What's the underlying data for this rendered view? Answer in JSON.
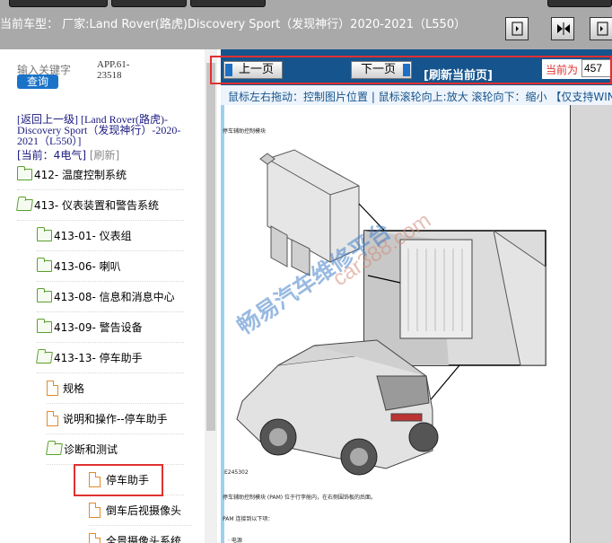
{
  "header": {
    "car_model": "当前车型：  厂家:Land Rover(路虎)Discovery Sport（发现神行）2020-2021（L550）"
  },
  "sidebar": {
    "keyword_placeholder": "输入关键字",
    "app_code": "APP.61-23518",
    "query_label": "查询",
    "back_link": "[返回上一级]  [Land Rover(路虎)-Discovery Sport（发现神行）-2020-2021（L550）]",
    "current": "[当前：4电气]",
    "refresh": "[刷新]",
    "tree": [
      {
        "label": "412- 温度控制系统",
        "icon": "folder-icon",
        "level": 0
      },
      {
        "label": "413- 仪表装置和警告系统",
        "icon": "folder-open-icon",
        "level": 0
      },
      {
        "label": "413-01- 仪表组",
        "icon": "folder-icon",
        "level": 1
      },
      {
        "label": "413-06- 喇叭",
        "icon": "folder-icon",
        "level": 1
      },
      {
        "label": "413-08- 信息和消息中心",
        "icon": "folder-icon",
        "level": 1
      },
      {
        "label": "413-09- 警告设备",
        "icon": "folder-icon",
        "level": 1
      },
      {
        "label": "413-13- 停车助手",
        "icon": "folder-open-icon",
        "level": 1
      },
      {
        "label": "规格",
        "icon": "document-icon",
        "level": 2
      },
      {
        "label": "说明和操作--停车助手",
        "icon": "document-icon",
        "level": 2
      },
      {
        "label": "诊断和测试",
        "icon": "folder-open-icon",
        "level": 2
      },
      {
        "label": "停车助手",
        "icon": "document-icon",
        "level": 3,
        "selected": true
      },
      {
        "label": "倒车后视摄像头",
        "icon": "document-icon",
        "level": 3
      },
      {
        "label": "全景摄像头系统",
        "icon": "document-icon",
        "level": 3
      }
    ]
  },
  "toolbar": {
    "prev_label": "上一页",
    "next_label": "下一页",
    "refresh_label": "[刷新当前页]",
    "current_label": "当前为",
    "current_page": "457"
  },
  "hint": "鼠标左右拖动：控制图片位置 | 鼠标滚轮向上:放大  滚轮向下：缩小 【仅支持WIN",
  "document": {
    "heading": "停车辅助控制模块",
    "figure_id": "E245302",
    "caption": "停车辅助控制模块 (PAM) 位于行李舱内，在右侧围饰板的后面。",
    "line2": "PAM 连接到以下项：",
    "line3": "· 电源",
    "watermark": "畅易汽车维修平台",
    "watermark_url": "car388.com"
  },
  "colors": {
    "toolbar_bg": "#16548d",
    "highlight": "#e03030",
    "query_btn": "#1a73c9"
  }
}
